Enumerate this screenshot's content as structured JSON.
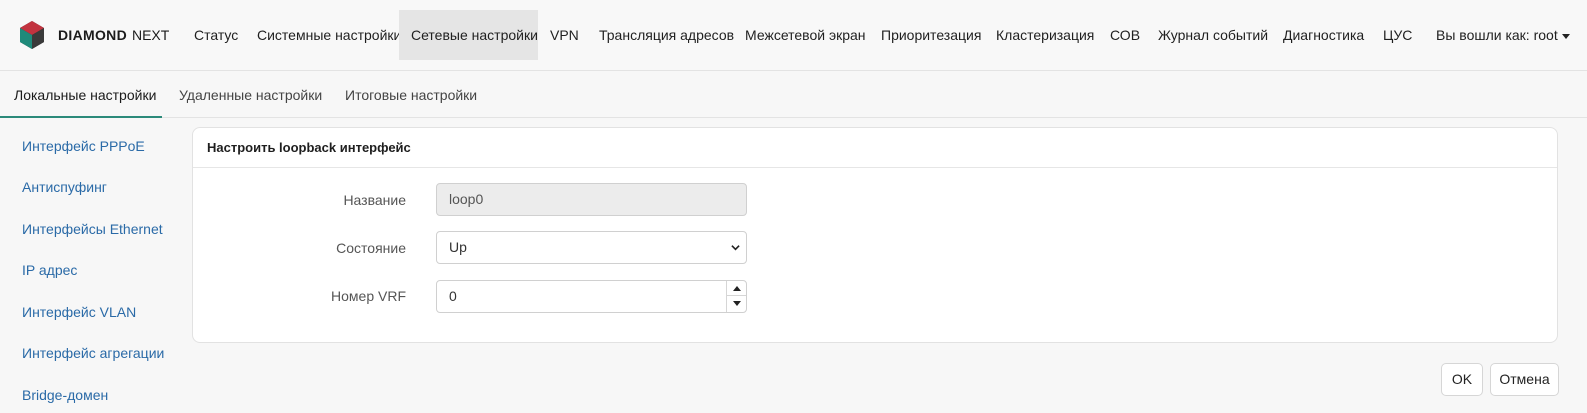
{
  "brand": {
    "name": "DIAMOND",
    "edition": "NEXT"
  },
  "nav": {
    "items": [
      "Статус",
      "Системные настройки",
      "Сетевые настройки",
      "VPN",
      "Трансляция адресов",
      "Межсетевой экран",
      "Приоритезация",
      "Кластеризация",
      "СОВ",
      "Журнал событий",
      "Диагностика",
      "ЦУС"
    ],
    "active": "Сетевые настройки",
    "user_label": "Вы вошли как: root"
  },
  "subtabs": {
    "items": [
      "Локальные настройки",
      "Удаленные настройки",
      "Итоговые настройки"
    ],
    "active": "Локальные настройки"
  },
  "sidebar": {
    "items": [
      "Интерфейс PPPoE",
      "Антиспуфинг",
      "Интерфейсы Ethernet",
      "IP адрес",
      "Интерфейс VLAN",
      "Интерфейс агрегации",
      "Bridge-домен"
    ]
  },
  "form": {
    "title": "Настроить loopback интерфейс",
    "name_label": "Название",
    "name_value": "loop0",
    "state_label": "Состояние",
    "state_value": "Up",
    "vrf_label": "Номер VRF",
    "vrf_value": "0"
  },
  "buttons": {
    "ok": "OK",
    "cancel": "Отмена"
  },
  "colors": {
    "accent": "#2b8a7a",
    "link": "#2a6aa7",
    "active_nav_bg": "#e5e5e5"
  }
}
